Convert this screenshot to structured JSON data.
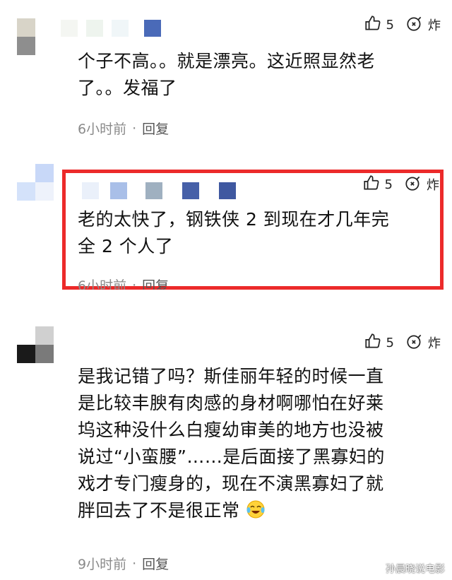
{
  "comments": [
    {
      "likes": "5",
      "dislike_label": "炸",
      "text_lines": [
        "个子不高。。就是漂亮。这近照显然老",
        "了。。发福了"
      ],
      "time": "6小时前",
      "separator": "·",
      "reply_label": "回复"
    },
    {
      "likes": "5",
      "dislike_label": "炸",
      "text_lines": [
        "老的太快了，钢铁侠 2 到现在才几年完",
        "全 2 个人了"
      ],
      "time": "6小时前",
      "separator": "·",
      "reply_label": "回复"
    },
    {
      "likes": "5",
      "dislike_label": "炸",
      "text_lines": [
        "是我记错了吗？斯佳丽年轻的时候一直",
        "是比较丰腴有肉感的身材啊哪怕在好莱",
        "坞这种没什么白瘦幼审美的地方也没被",
        "说过“小蛮腰”……是后面接了黑寡妇的",
        "戏才专门瘦身的，现在不演黑寡妇了就",
        "胖回去了不是很正常"
      ],
      "time": "9小时前",
      "separator": "·",
      "reply_label": "回复"
    }
  ],
  "watermark": "孙晨晓说电影",
  "icons": {
    "like": "thumbs-up-icon",
    "dislike": "bomb-icon",
    "emoji": "crying-laughing-emoji"
  },
  "colors": {
    "highlight_border": "#ec2a2a",
    "meta_text": "#8a8a8a"
  }
}
